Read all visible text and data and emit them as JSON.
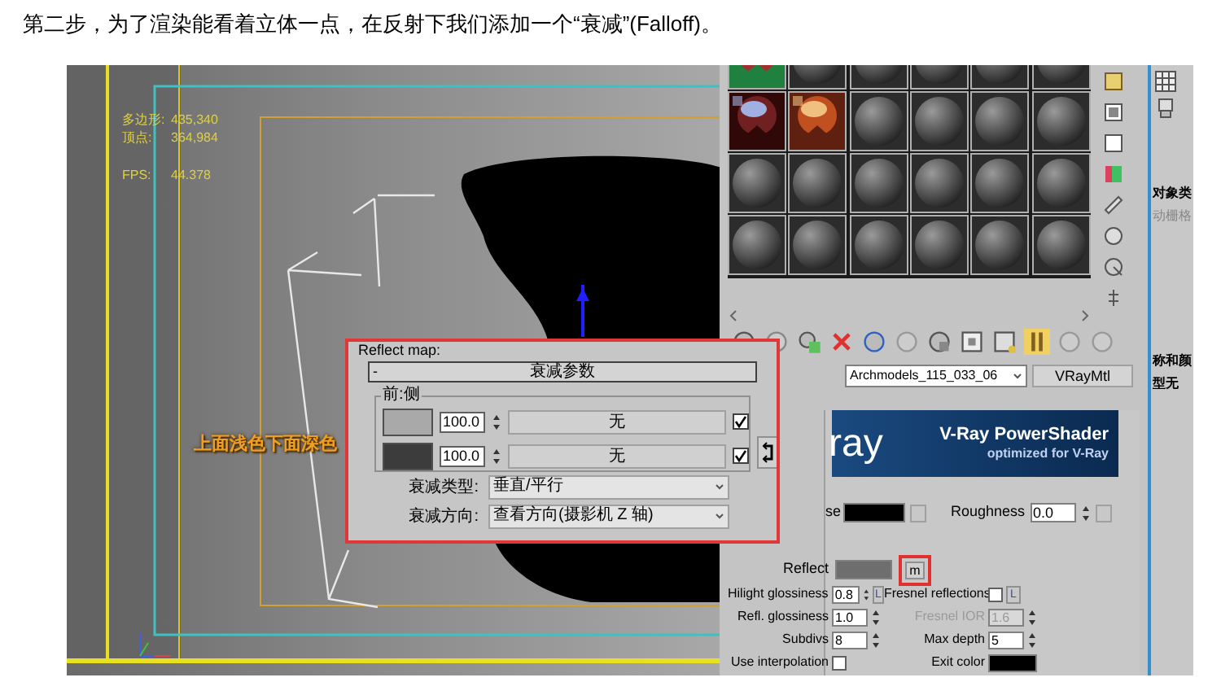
{
  "caption": "第二步，为了渲染能看着立体一点，在反射下我们添加一个“衰减”(Falloff)。",
  "viewport": {
    "stats": [
      {
        "label": "多边形:",
        "value": "435,340"
      },
      {
        "label": "顶点:",
        "value": "364,984"
      },
      {
        "label": "FPS:",
        "value": "44.378"
      }
    ],
    "annotation": "上面浅色下面深色"
  },
  "falloff_dialog": {
    "reflect_map_label": "Reflect map:",
    "rollout_title": "衰减参数",
    "rollout_toggle": "-",
    "group_label": "前:侧",
    "rows": [
      {
        "color": "#a9a9a9",
        "amount": "100.0",
        "map": "无",
        "checked": true
      },
      {
        "color": "#3c3c3c",
        "amount": "100.0",
        "map": "无",
        "checked": true
      }
    ],
    "fields": [
      {
        "label": "衰减类型:",
        "value": "垂直/平行"
      },
      {
        "label": "衰减方向:",
        "value": "查看方向(摄影机 Z 轴)"
      }
    ]
  },
  "material_editor": {
    "slots": [
      {
        "kind": "picture"
      },
      {
        "kind": "sphere"
      },
      {
        "kind": "sphere"
      },
      {
        "kind": "sphere"
      },
      {
        "kind": "sphere"
      },
      {
        "kind": "sphere"
      },
      {
        "kind": "picture"
      },
      {
        "kind": "picture"
      },
      {
        "kind": "sphere"
      },
      {
        "kind": "sphere"
      },
      {
        "kind": "sphere"
      },
      {
        "kind": "sphere"
      },
      {
        "kind": "sphere"
      },
      {
        "kind": "sphere"
      },
      {
        "kind": "sphere"
      },
      {
        "kind": "sphere"
      },
      {
        "kind": "sphere"
      },
      {
        "kind": "sphere"
      },
      {
        "kind": "sphere"
      },
      {
        "kind": "sphere"
      },
      {
        "kind": "sphere"
      },
      {
        "kind": "sphere"
      },
      {
        "kind": "sphere"
      },
      {
        "kind": "sphere"
      }
    ],
    "material_name": "Archmodels_115_033_06",
    "material_type": "VRayMtl",
    "banner": {
      "logo": "ray",
      "title": "V-Ray PowerShader",
      "subtitle": "optimized for V-Ray"
    },
    "diffuse_label": "se",
    "roughness_label": "Roughness",
    "roughness_value": "0.0",
    "reflect_label": "Reflect",
    "reflect_map_button": "m",
    "params": [
      {
        "kind": "field",
        "label": "Hilight glossiness",
        "value": "0.8",
        "lock": "L",
        "disabled": false
      },
      {
        "kind": "checkbox",
        "label": "Fresnel reflections",
        "checked": false,
        "lock": "L",
        "disabled": false
      },
      {
        "kind": "field",
        "label": "Refl. glossiness",
        "value": "1.0",
        "disabled": false
      },
      {
        "kind": "field",
        "label": "Fresnel IOR",
        "value": "1.6",
        "disabled": true
      },
      {
        "kind": "field",
        "label": "Subdivs",
        "value": "8",
        "disabled": false
      },
      {
        "kind": "field",
        "label": "Max depth",
        "value": "5",
        "disabled": false
      },
      {
        "kind": "checkbox",
        "label": "Use interpolation",
        "checked": false,
        "disabled": false
      },
      {
        "kind": "color",
        "label": "Exit color",
        "color": "#000000",
        "disabled": false
      }
    ]
  },
  "command_panel": {
    "labels": [
      "对象类",
      "动栅格",
      "称和颜",
      "型无"
    ]
  }
}
